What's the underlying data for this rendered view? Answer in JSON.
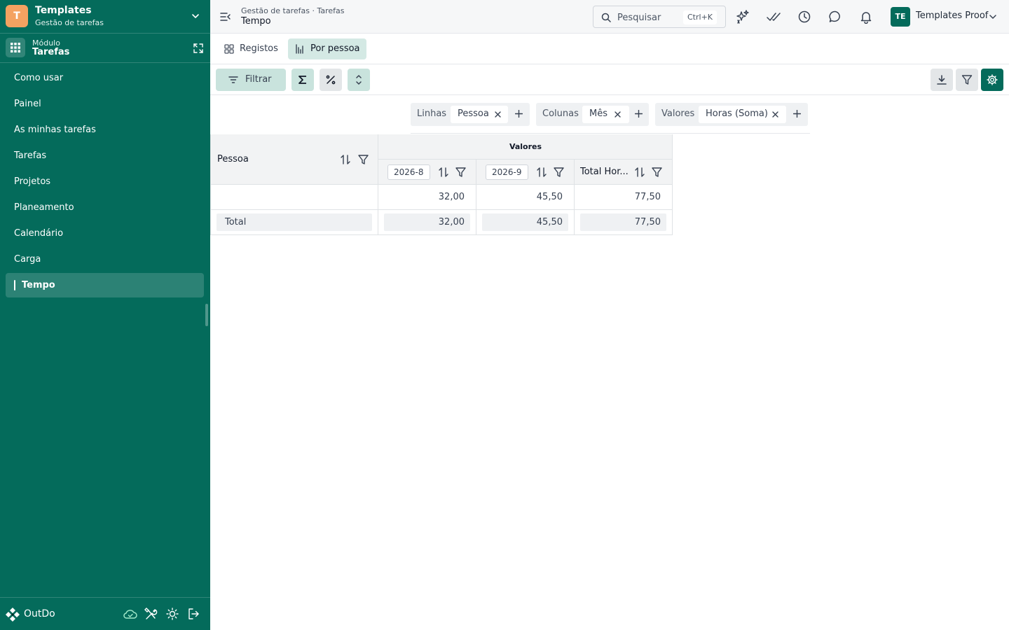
{
  "workspace": {
    "logo_letter": "T",
    "title": "Templates",
    "subtitle": "Gestão de tarefas"
  },
  "module": {
    "label": "Módulo",
    "name": "Tarefas"
  },
  "sidebar": {
    "items": [
      {
        "label": "Como usar"
      },
      {
        "label": "Painel"
      },
      {
        "label": "As minhas tarefas"
      },
      {
        "label": "Tarefas"
      },
      {
        "label": "Projetos"
      },
      {
        "label": "Planeamento"
      },
      {
        "label": "Calendário"
      },
      {
        "label": "Carga"
      },
      {
        "label": "Tempo",
        "active": true
      }
    ]
  },
  "footer": {
    "brand": "OutDo"
  },
  "header": {
    "breadcrumb": "Gestão de tarefas · Tarefas",
    "title": "Tempo",
    "search": {
      "placeholder": "Pesquisar",
      "shortcut": "Ctrl+K"
    },
    "user": {
      "initials": "TE",
      "name": "Templates Proof"
    }
  },
  "views": [
    {
      "label": "Registos",
      "icon": "grid-icon"
    },
    {
      "label": "Por pessoa",
      "icon": "bar-chart-icon",
      "active": true
    }
  ],
  "toolbar": {
    "filter_label": "Filtrar"
  },
  "pivot_config": {
    "rows": {
      "label": "Linhas",
      "field": "Pessoa"
    },
    "columns": {
      "label": "Colunas",
      "field": "Mês"
    },
    "values": {
      "label": "Valores",
      "field": "Horas (Soma)"
    }
  },
  "pivot": {
    "row_header": "Pessoa",
    "values_header": "Valores",
    "columns": [
      "2026-8",
      "2026-9",
      "Total Hor..."
    ],
    "rows": [
      {
        "label": "",
        "values": [
          "32,00",
          "45,50",
          "77,50"
        ]
      }
    ],
    "total": {
      "label": "Total",
      "values": [
        "32,00",
        "45,50",
        "77,50"
      ]
    }
  },
  "colors": {
    "sidebar": "#046b5b",
    "accent_light": "#c9e3dd",
    "workspace_logo": "#f4a261"
  }
}
